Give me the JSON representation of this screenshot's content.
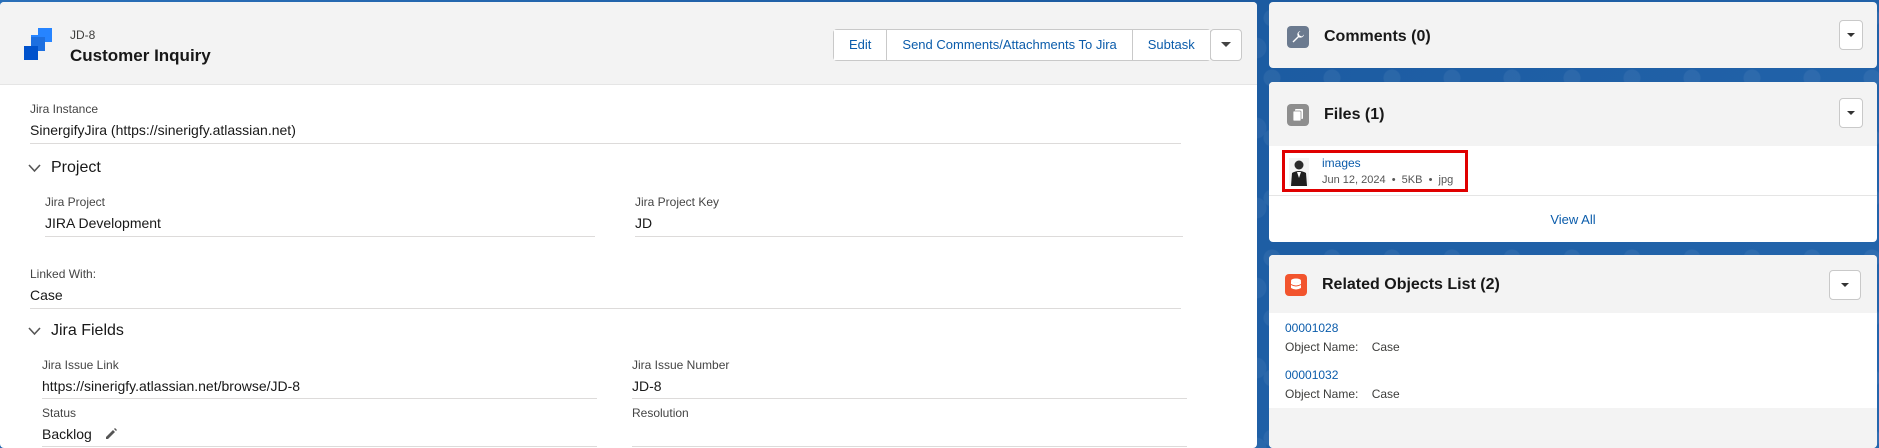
{
  "record": {
    "type": "JD-8",
    "title": "Customer Inquiry",
    "actions": [
      "Edit",
      "Send Comments/Attachments To Jira",
      "Subtask"
    ]
  },
  "details": {
    "jira_instance_label": "Jira Instance",
    "jira_instance_value": "SinergifyJira (https://sinerigfy.atlassian.net)",
    "project_section": "Project",
    "jira_project_label": "Jira Project",
    "jira_project_value": "JIRA Development",
    "jira_project_key_label": "Jira Project Key",
    "jira_project_key_value": "JD",
    "linked_with_label": "Linked With:",
    "linked_with_value": "Case",
    "jira_fields_section": "Jira Fields",
    "issue_link_label": "Jira Issue Link",
    "issue_link_value": "https://sinerigfy.atlassian.net/browse/JD-8",
    "issue_number_label": "Jira Issue Number",
    "issue_number_value": "JD-8",
    "status_label": "Status",
    "status_value": "Backlog",
    "resolution_label": "Resolution"
  },
  "comments": {
    "title": "Comments (0)"
  },
  "files": {
    "title": "Files (1)",
    "file_name": "images",
    "file_meta": "Jun 12, 2024  •  5KB  •  jpg",
    "view_all": "View All",
    "highlight_color": "#e00000"
  },
  "related": {
    "title": "Related Objects List (2)",
    "items": [
      {
        "id": "00001028",
        "field_label": "Object Name:",
        "field_value": "Case"
      },
      {
        "id": "00001032",
        "field_label": "Object Name:",
        "field_value": "Case"
      }
    ]
  },
  "colors": {
    "link": "#0b5cab",
    "comments_icon": "#6b7a8f",
    "files_icon": "#8e8e8e",
    "related_icon": "#f2542d"
  }
}
